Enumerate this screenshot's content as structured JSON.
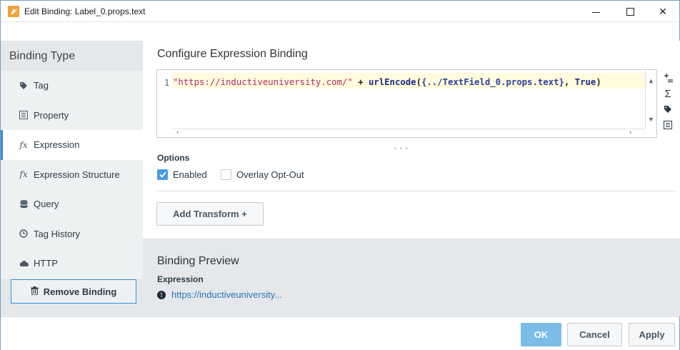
{
  "window": {
    "title": "Edit Binding: Label_0.props.text",
    "icon": "perspective-edit-icon"
  },
  "sidebar": {
    "title": "Binding Type",
    "items": [
      {
        "label": "Tag",
        "icon": "tag-icon",
        "active": false
      },
      {
        "label": "Property",
        "icon": "property-icon",
        "active": false
      },
      {
        "label": "Expression",
        "icon": "fx-icon",
        "active": true
      },
      {
        "label": "Expression Structure",
        "icon": "fx-icon",
        "active": false
      },
      {
        "label": "Query",
        "icon": "database-icon",
        "active": false
      },
      {
        "label": "Tag History",
        "icon": "clock-icon",
        "active": false
      },
      {
        "label": "HTTP",
        "icon": "cloud-icon",
        "active": false
      }
    ],
    "remove_label": "Remove Binding"
  },
  "editor": {
    "title": "Configure Expression Binding",
    "line_number": "1",
    "code_string": "\"https://inductiveuniversity.com/\"",
    "code_op": " + ",
    "code_fn": "urlEncode",
    "code_open": "(",
    "code_prop": "{../TextField_0.props.text}",
    "code_comma": ", ",
    "code_kw": "True",
    "code_close": ")"
  },
  "options": {
    "label": "Options",
    "enabled_label": "Enabled",
    "enabled_checked": true,
    "overlay_label": "Overlay Opt-Out",
    "overlay_checked": false
  },
  "transform": {
    "add_label": "Add Transform +"
  },
  "preview": {
    "title": "Binding Preview",
    "label": "Expression",
    "value": "https://inductiveuniversity..."
  },
  "footer": {
    "ok_label": "OK",
    "cancel_label": "Cancel",
    "apply_label": "Apply"
  },
  "colors": {
    "accent": "#3a8dd3",
    "ok_button": "#7bbde8",
    "sidebar_bg": "#e4e8ea"
  }
}
